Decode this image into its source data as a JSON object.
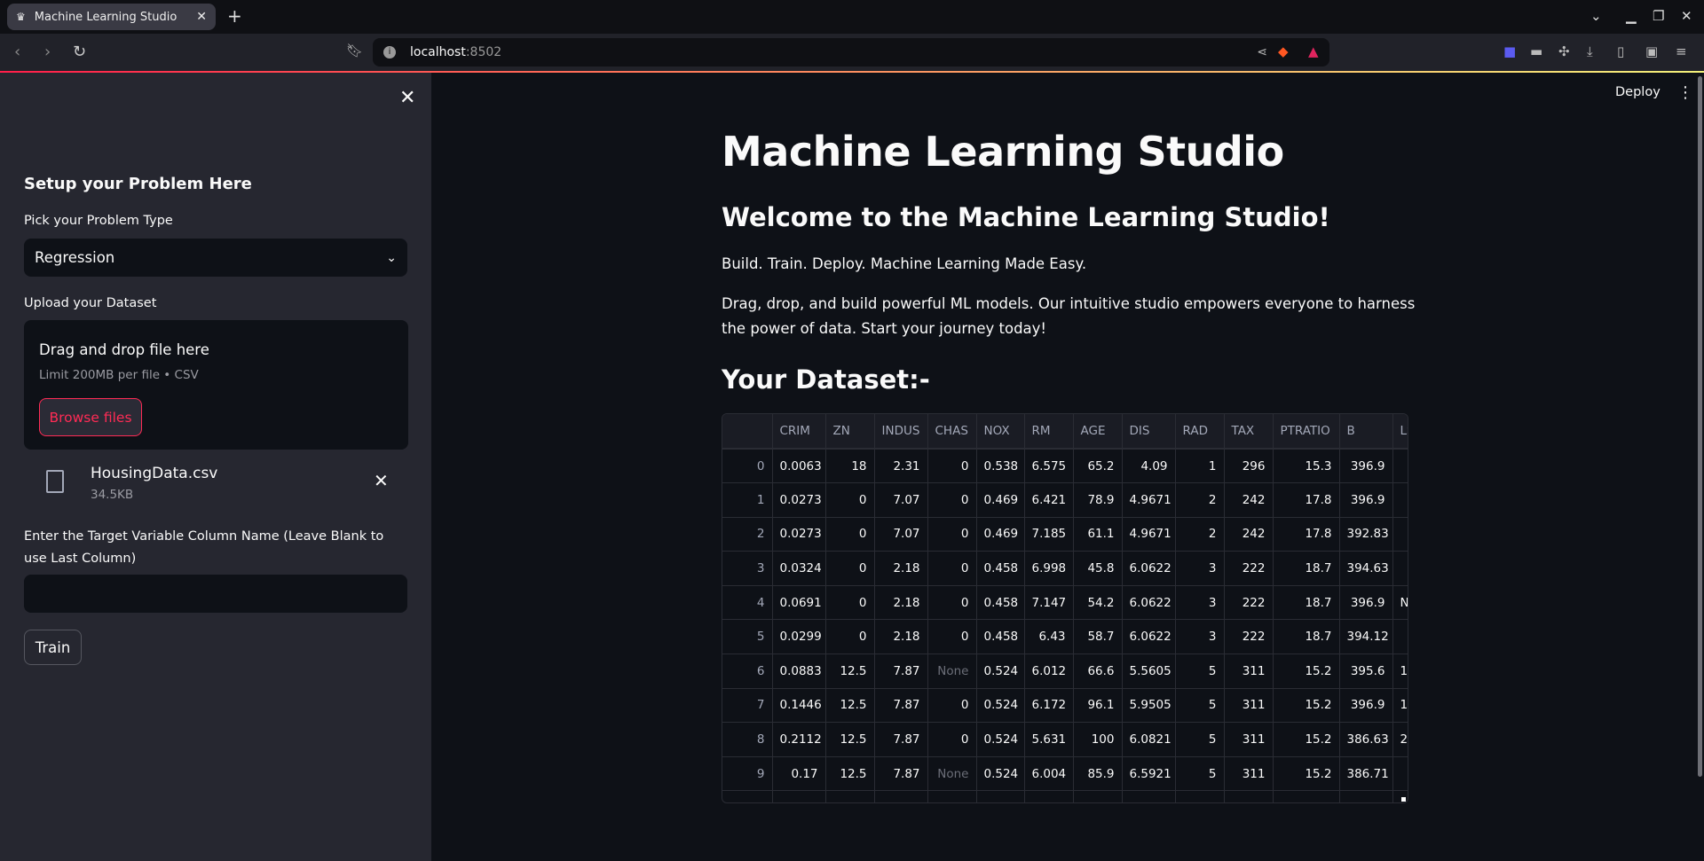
{
  "browser": {
    "tab_title": "Machine Learning Studio",
    "url_host": "localhost",
    "url_port": ":8502"
  },
  "sidebar": {
    "heading": "Setup your Problem Here",
    "problem_type_label": "Pick your Problem Type",
    "problem_type_value": "Regression",
    "upload_label": "Upload your Dataset",
    "drop_text": "Drag and drop file here",
    "drop_limit": "Limit 200MB per file • CSV",
    "browse_label": "Browse files",
    "file_name": "HousingData.csv",
    "file_size": "34.5KB",
    "target_label": "Enter the Target Variable Column Name (Leave Blank to use Last Column)",
    "target_value": "",
    "train_label": "Train"
  },
  "header": {
    "deploy_label": "Deploy"
  },
  "main": {
    "title": "Machine Learning Studio",
    "welcome": "Welcome to the Machine Learning Studio!",
    "tagline": "Build. Train. Deploy. Machine Learning Made Easy.",
    "description": "Drag, drop, and build powerful ML models. Our intuitive studio empowers everyone to harness the power of data. Start your journey today!",
    "dataset_heading": "Your Dataset:-"
  },
  "table": {
    "columns": [
      "",
      "CRIM",
      "ZN",
      "INDUS",
      "CHAS",
      "NOX",
      "RM",
      "AGE",
      "DIS",
      "RAD",
      "TAX",
      "PTRATIO",
      "B",
      "LS"
    ],
    "rows": [
      [
        "0",
        "0.0063",
        "18",
        "2.31",
        "0",
        "0.538",
        "6.575",
        "65.2",
        "4.09",
        "1",
        "296",
        "15.3",
        "396.9",
        ""
      ],
      [
        "1",
        "0.0273",
        "0",
        "7.07",
        "0",
        "0.469",
        "6.421",
        "78.9",
        "4.9671",
        "2",
        "242",
        "17.8",
        "396.9",
        ""
      ],
      [
        "2",
        "0.0273",
        "0",
        "7.07",
        "0",
        "0.469",
        "7.185",
        "61.1",
        "4.9671",
        "2",
        "242",
        "17.8",
        "392.83",
        ""
      ],
      [
        "3",
        "0.0324",
        "0",
        "2.18",
        "0",
        "0.458",
        "6.998",
        "45.8",
        "6.0622",
        "3",
        "222",
        "18.7",
        "394.63",
        ""
      ],
      [
        "4",
        "0.0691",
        "0",
        "2.18",
        "0",
        "0.458",
        "7.147",
        "54.2",
        "6.0622",
        "3",
        "222",
        "18.7",
        "396.9",
        "N"
      ],
      [
        "5",
        "0.0299",
        "0",
        "2.18",
        "0",
        "0.458",
        "6.43",
        "58.7",
        "6.0622",
        "3",
        "222",
        "18.7",
        "394.12",
        ""
      ],
      [
        "6",
        "0.0883",
        "12.5",
        "7.87",
        "None",
        "0.524",
        "6.012",
        "66.6",
        "5.5605",
        "5",
        "311",
        "15.2",
        "395.6",
        "1"
      ],
      [
        "7",
        "0.1446",
        "12.5",
        "7.87",
        "0",
        "0.524",
        "6.172",
        "96.1",
        "5.9505",
        "5",
        "311",
        "15.2",
        "396.9",
        "1"
      ],
      [
        "8",
        "0.2112",
        "12.5",
        "7.87",
        "0",
        "0.524",
        "5.631",
        "100",
        "6.0821",
        "5",
        "311",
        "15.2",
        "386.63",
        "2"
      ],
      [
        "9",
        "0.17",
        "12.5",
        "7.87",
        "None",
        "0.524",
        "6.004",
        "85.9",
        "6.5921",
        "5",
        "311",
        "15.2",
        "386.71",
        ""
      ]
    ]
  },
  "colors": {
    "accent": "#ff2b55",
    "sidebar_bg": "#262730",
    "main_bg": "#0e1117"
  }
}
